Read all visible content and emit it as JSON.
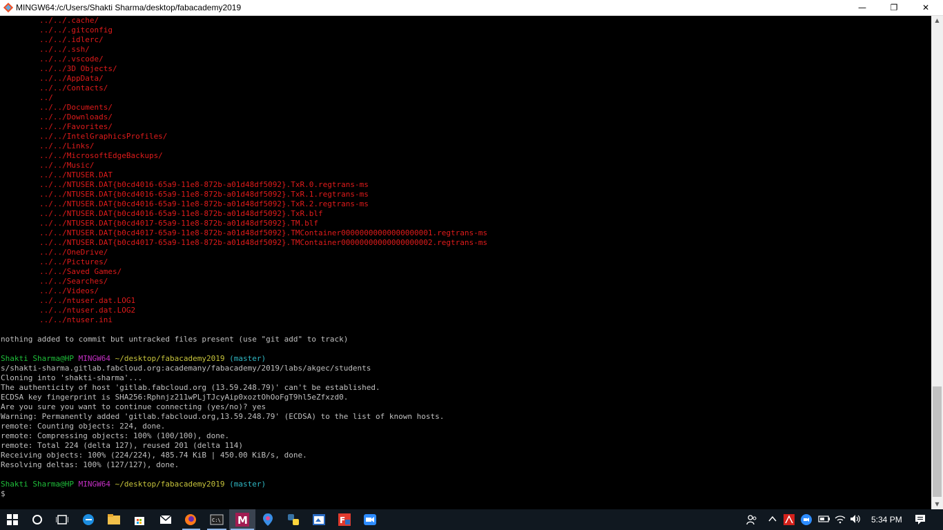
{
  "window": {
    "title": "MINGW64:/c/Users/Shakti Sharma/desktop/fabacademy2019",
    "minimize_glyph": "—",
    "maximize_glyph": "❐",
    "close_glyph": "✕"
  },
  "terminal": {
    "untracked_files": [
      "../../.cache/",
      "../../.gitconfig",
      "../../.idlerc/",
      "../../.ssh/",
      "../../.vscode/",
      "../../3D Objects/",
      "../../AppData/",
      "../../Contacts/",
      "../",
      "../../Documents/",
      "../../Downloads/",
      "../../Favorites/",
      "../../IntelGraphicsProfiles/",
      "../../Links/",
      "../../MicrosoftEdgeBackups/",
      "../../Music/",
      "../../NTUSER.DAT",
      "../../NTUSER.DAT{b0cd4016-65a9-11e8-872b-a01d48df5092}.TxR.0.regtrans-ms",
      "../../NTUSER.DAT{b0cd4016-65a9-11e8-872b-a01d48df5092}.TxR.1.regtrans-ms",
      "../../NTUSER.DAT{b0cd4016-65a9-11e8-872b-a01d48df5092}.TxR.2.regtrans-ms",
      "../../NTUSER.DAT{b0cd4016-65a9-11e8-872b-a01d48df5092}.TxR.blf",
      "../../NTUSER.DAT{b0cd4017-65a9-11e8-872b-a01d48df5092}.TM.blf",
      "../../NTUSER.DAT{b0cd4017-65a9-11e8-872b-a01d48df5092}.TMContainer00000000000000000001.regtrans-ms",
      "../../NTUSER.DAT{b0cd4017-65a9-11e8-872b-a01d48df5092}.TMContainer00000000000000000002.regtrans-ms",
      "../../OneDrive/",
      "../../Pictures/",
      "../../Saved Games/",
      "../../Searches/",
      "../../Videos/",
      "../../ntuser.dat.LOG1",
      "../../ntuser.dat.LOG2",
      "../../ntuser.ini"
    ],
    "status_message": "nothing added to commit but untracked files present (use \"git add\" to track)",
    "prompt1": {
      "user": "Shakti Sharma@HP",
      "shell": "MINGW64",
      "path": "~/desktop/fabacademy2019",
      "branch": "(master)"
    },
    "command_wrap": "s/shakti-sharma.gitlab.fabcloud.org:academany/fabacademy/2019/labs/akgec/students",
    "output": [
      "Cloning into 'shakti-sharma'...",
      "The authenticity of host 'gitlab.fabcloud.org (13.59.248.79)' can't be established.",
      "ECDSA key fingerprint is SHA256:Rphnjz211wPLjTJcyAip0xoztOhOoFgT9hl5eZfxzd0.",
      "Are you sure you want to continue connecting (yes/no)? yes",
      "Warning: Permanently added 'gitlab.fabcloud.org,13.59.248.79' (ECDSA) to the list of known hosts.",
      "remote: Counting objects: 224, done.",
      "remote: Compressing objects: 100% (100/100), done.",
      "remote: Total 224 (delta 127), reused 201 (delta 114)",
      "Receiving objects: 100% (224/224), 485.74 KiB | 450.00 KiB/s, done.",
      "Resolving deltas: 100% (127/127), done."
    ],
    "prompt2": {
      "user": "Shakti Sharma@HP",
      "shell": "MINGW64",
      "path": "~/desktop/fabacademy2019",
      "branch": "(master)"
    },
    "cursor_line": "$"
  },
  "taskbar": {
    "clock": "5:34 PM",
    "icons": [
      "windows-start-icon",
      "cortana-search-icon",
      "task-view-icon",
      "edge-browser-icon",
      "file-explorer-icon",
      "store-icon",
      "mail-icon",
      "firefox-icon",
      "command-prompt-icon",
      "git-bash-icon",
      "map-pin-icon",
      "python-icon",
      "paint-icon",
      "foxit-icon",
      "zoom-icon"
    ]
  }
}
